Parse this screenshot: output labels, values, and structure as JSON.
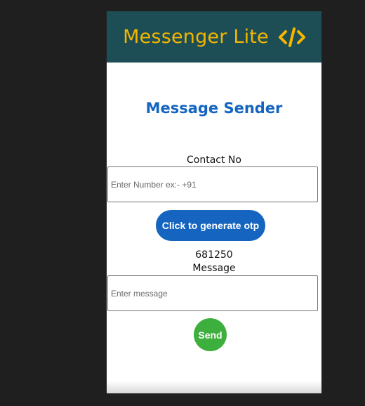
{
  "header": {
    "title": "Messenger Lite",
    "icon": "code-icon",
    "background_color": "#1d4e55",
    "title_color": "#f2b600"
  },
  "main": {
    "page_title": "Message Sender",
    "contact": {
      "label": "Contact No",
      "placeholder": "Enter Number ex:- +91",
      "value": ""
    },
    "otp_button_label": "Click to generate otp",
    "otp_value": "681250",
    "message": {
      "label": "Message",
      "placeholder": "Enter message",
      "value": ""
    },
    "send_button_label": "Send"
  },
  "colors": {
    "primary": "#1565c0",
    "send": "#3daf3d",
    "page_background": "#1f1f1f"
  }
}
